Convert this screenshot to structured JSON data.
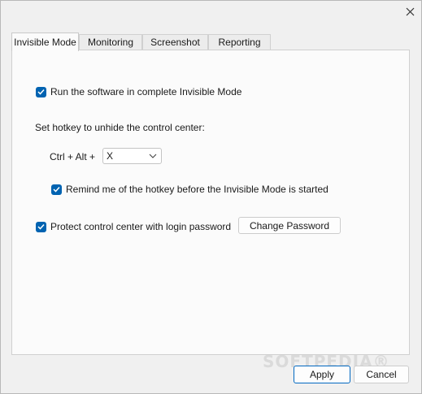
{
  "window": {
    "close_icon": "close-icon"
  },
  "tabs": [
    {
      "label": "Invisible Mode",
      "active": true
    },
    {
      "label": "Monitoring",
      "active": false
    },
    {
      "label": "Screenshot",
      "active": false
    },
    {
      "label": "Reporting",
      "active": false
    }
  ],
  "invisible_mode": {
    "run_invisible": {
      "label": "Run the software in complete Invisible Mode",
      "checked": true
    },
    "hotkey_heading": "Set hotkey to unhide the control center:",
    "hotkey_prefix": "Ctrl + Alt +",
    "hotkey_key": {
      "value": "X",
      "options_icon": "chevron-down-icon"
    },
    "remind_hotkey": {
      "label": "Remind me of the hotkey before the Invisible Mode is started",
      "checked": true
    },
    "protect_password": {
      "label": "Protect control center with login password",
      "checked": true
    },
    "change_password_label": "Change Password"
  },
  "footer": {
    "apply_label": "Apply",
    "cancel_label": "Cancel"
  },
  "watermark": "SOFTPEDIA®",
  "colors": {
    "accent": "#0063b1",
    "background": "#f0f0f0",
    "panel": "#fbfbfb"
  }
}
